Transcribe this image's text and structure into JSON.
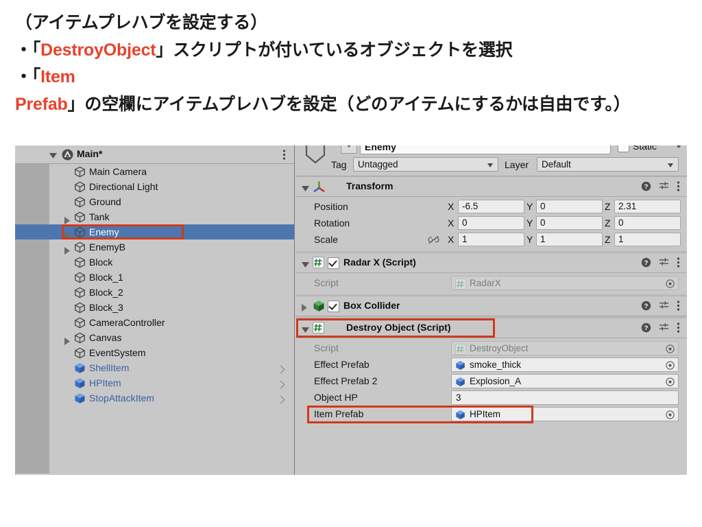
{
  "slide": {
    "line1": "（アイテムプレハブを設定する）",
    "bullet1_pre": "・「",
    "bullet1_hl": "DestroyObject",
    "bullet1_post": "」スクリプトが付いているオブジェクトを選択",
    "bullet2_pre": "・「",
    "bullet2_hl": "Item Prefab",
    "bullet2_post": "」の空欄にアイテムプレハブを設定（どのアイテムにするかは自由です。）",
    "highlight_color": "#e8422b"
  },
  "hierarchy": {
    "scene_name": "Main*",
    "scene_expand_icon": "triangle-down-icon",
    "unity_icon": "unity-logo-icon",
    "menu_icon": "kebab-menu-icon",
    "items": [
      {
        "label": "Main Camera",
        "indent": 0,
        "expandable": false,
        "prefab": false,
        "selected": false,
        "chevron": false
      },
      {
        "label": "Directional Light",
        "indent": 0,
        "expandable": false,
        "prefab": false,
        "selected": false,
        "chevron": false
      },
      {
        "label": "Ground",
        "indent": 0,
        "expandable": false,
        "prefab": false,
        "selected": false,
        "chevron": false
      },
      {
        "label": "Tank",
        "indent": 0,
        "expandable": true,
        "prefab": false,
        "selected": false,
        "chevron": false
      },
      {
        "label": "Enemy",
        "indent": 0,
        "expandable": true,
        "prefab": false,
        "selected": true,
        "chevron": false
      },
      {
        "label": "EnemyB",
        "indent": 0,
        "expandable": true,
        "prefab": false,
        "selected": false,
        "chevron": false
      },
      {
        "label": "Block",
        "indent": 0,
        "expandable": false,
        "prefab": false,
        "selected": false,
        "chevron": false
      },
      {
        "label": "Block_1",
        "indent": 0,
        "expandable": false,
        "prefab": false,
        "selected": false,
        "chevron": false
      },
      {
        "label": "Block_2",
        "indent": 0,
        "expandable": false,
        "prefab": false,
        "selected": false,
        "chevron": false
      },
      {
        "label": "Block_3",
        "indent": 0,
        "expandable": false,
        "prefab": false,
        "selected": false,
        "chevron": false
      },
      {
        "label": "CameraController",
        "indent": 0,
        "expandable": false,
        "prefab": false,
        "selected": false,
        "chevron": false
      },
      {
        "label": "Canvas",
        "indent": 0,
        "expandable": true,
        "prefab": false,
        "selected": false,
        "chevron": false
      },
      {
        "label": "EventSystem",
        "indent": 0,
        "expandable": false,
        "prefab": false,
        "selected": false,
        "chevron": false
      },
      {
        "label": "ShellItem",
        "indent": 0,
        "expandable": false,
        "prefab": true,
        "selected": false,
        "chevron": true
      },
      {
        "label": "HPItem",
        "indent": 0,
        "expandable": false,
        "prefab": true,
        "selected": false,
        "chevron": true
      },
      {
        "label": "StopAttackItem",
        "indent": 0,
        "expandable": false,
        "prefab": true,
        "selected": false,
        "chevron": true
      }
    ]
  },
  "inspector": {
    "gameobject": {
      "name": "Enemy",
      "static_label": "Static",
      "static_checked": false,
      "tag_label": "Tag",
      "tag_value": "Untagged",
      "layer_label": "Layer",
      "layer_value": "Default"
    },
    "components": [
      {
        "name": "Transform",
        "icon": "transform-gizmo-icon",
        "expanded": true,
        "has_checkbox": false,
        "highlighted": false,
        "rows": [
          {
            "label": "Position",
            "type": "vector3",
            "x": "-6.5",
            "y": "0",
            "z": "2.31",
            "link": false
          },
          {
            "label": "Rotation",
            "type": "vector3",
            "x": "0",
            "y": "0",
            "z": "0",
            "link": false
          },
          {
            "label": "Scale",
            "type": "vector3",
            "x": "1",
            "y": "1",
            "z": "1",
            "link": true
          }
        ]
      },
      {
        "name": "Radar X (Script)",
        "icon": "csharp-script-icon",
        "expanded": true,
        "has_checkbox": true,
        "checked": true,
        "highlighted": false,
        "rows": [
          {
            "label": "Script",
            "type": "object",
            "value": "RadarX",
            "value_icon": "csharp-script-icon",
            "disabled": true
          }
        ]
      },
      {
        "name": "Box Collider",
        "icon": "box-collider-icon",
        "expanded": false,
        "has_checkbox": true,
        "checked": true,
        "highlighted": false,
        "rows": []
      },
      {
        "name": "Destroy Object (Script)",
        "icon": "csharp-script-icon",
        "expanded": true,
        "has_checkbox": false,
        "highlighted": true,
        "rows": [
          {
            "label": "Script",
            "type": "object",
            "value": "DestroyObject",
            "value_icon": "csharp-script-icon",
            "disabled": true
          },
          {
            "label": "Effect Prefab",
            "type": "object",
            "value": "smoke_thick",
            "value_icon": "prefab-cube-icon",
            "disabled": false
          },
          {
            "label": "Effect Prefab 2",
            "type": "object",
            "value": "Explosion_A",
            "value_icon": "prefab-cube-icon",
            "disabled": false
          },
          {
            "label": "Object HP",
            "type": "text",
            "value": "3"
          },
          {
            "label": "Item Prefab",
            "type": "object",
            "value": "HPItem",
            "value_icon": "prefab-cube-icon",
            "disabled": false,
            "highlighted": true
          }
        ]
      }
    ],
    "header_action_icons": [
      "help-icon",
      "preset-icon",
      "kebab-menu-icon"
    ],
    "axis_labels": {
      "x": "X",
      "y": "Y",
      "z": "Z"
    }
  },
  "colors": {
    "selection_blue": "#4d76ae",
    "highlight_red": "#d2391b",
    "prefab_blue": "#3b5fa4",
    "panel_grey": "#c8c8c8"
  }
}
